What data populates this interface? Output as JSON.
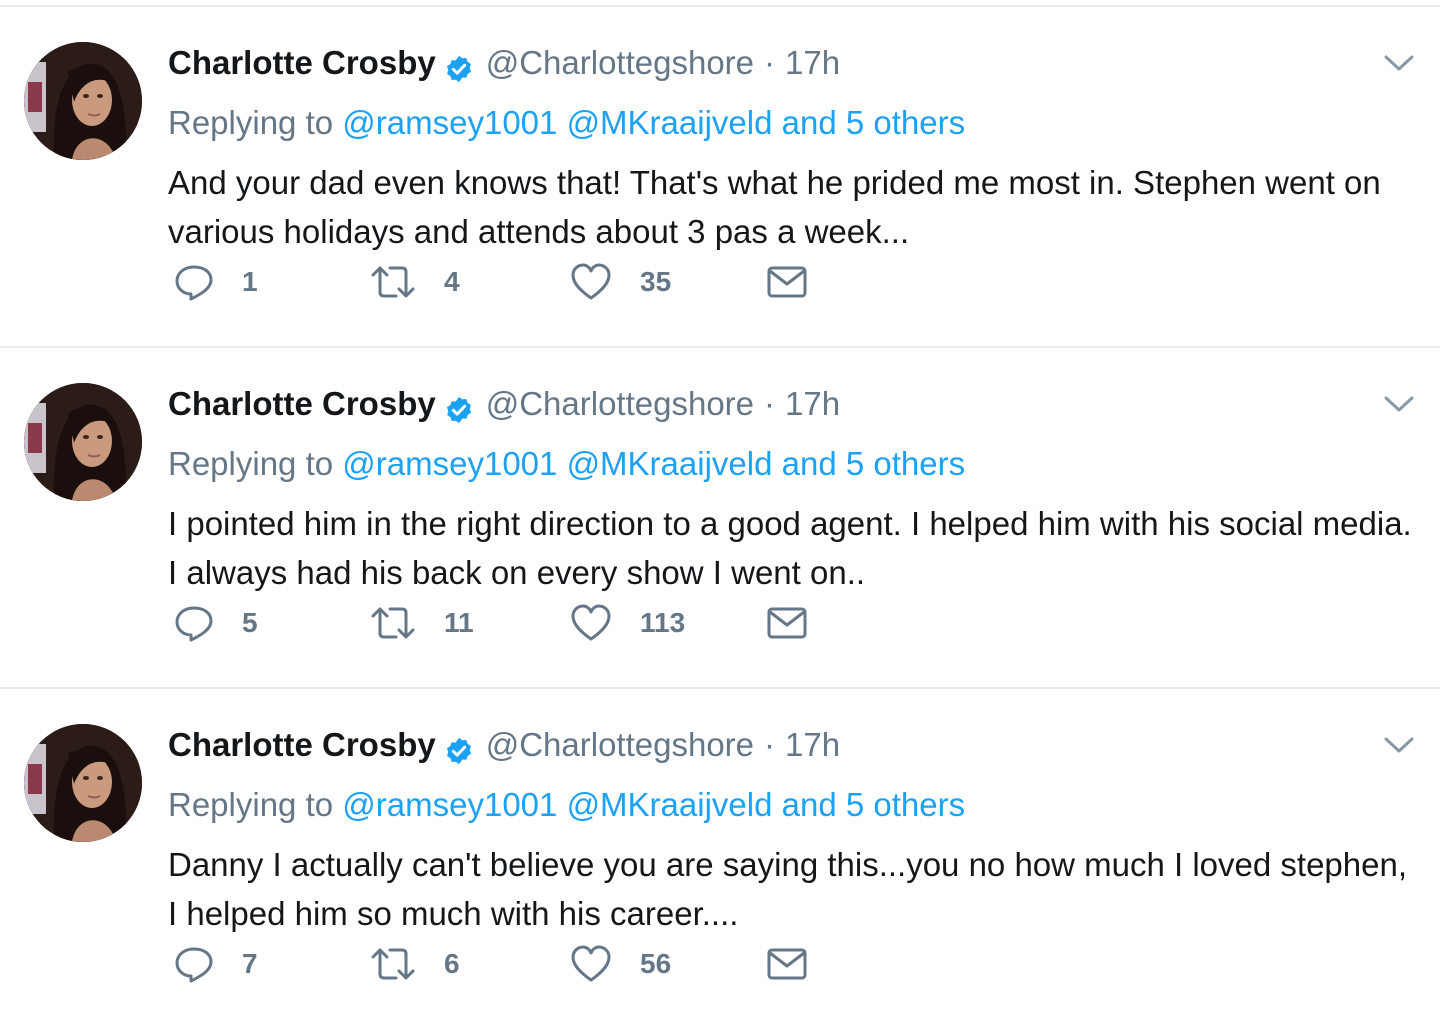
{
  "colors": {
    "link": "#1da1f2",
    "secondary_text": "#657786",
    "primary_text": "#14171a",
    "divider": "#e6ecf0"
  },
  "tweets": [
    {
      "name": "Charlotte Crosby",
      "handle": "@Charlottegshore",
      "separator": "·",
      "time": "17h",
      "replying_prefix": "Replying to",
      "mention1": "@ramsey1001",
      "mention2": "@MKraaijveld",
      "others": "and 5 others",
      "text": "And your dad even knows that! That's what he prided me most in. Stephen went on various holidays and attends about 3 pas a week...",
      "replies": "1",
      "retweets": "4",
      "likes": "35"
    },
    {
      "name": "Charlotte Crosby",
      "handle": "@Charlottegshore",
      "separator": "·",
      "time": "17h",
      "replying_prefix": "Replying to",
      "mention1": "@ramsey1001",
      "mention2": "@MKraaijveld",
      "others": "and 5 others",
      "text": "I pointed him in the right direction to a good agent. I helped him with his social media. I always had his back on every show I went on..",
      "replies": "5",
      "retweets": "11",
      "likes": "113"
    },
    {
      "name": "Charlotte Crosby",
      "handle": "@Charlottegshore",
      "separator": "·",
      "time": "17h",
      "replying_prefix": "Replying to",
      "mention1": "@ramsey1001",
      "mention2": "@MKraaijveld",
      "others": "and 5 others",
      "text": "Danny I actually can't believe you are saying this...you no how much I loved stephen, I helped him so much with his career....",
      "replies": "7",
      "retweets": "6",
      "likes": "56"
    }
  ],
  "icons": {
    "verified": "verified-badge-icon",
    "caret": "chevron-down-icon",
    "reply": "reply-icon",
    "retweet": "retweet-icon",
    "like": "heart-icon",
    "dm": "envelope-icon"
  }
}
